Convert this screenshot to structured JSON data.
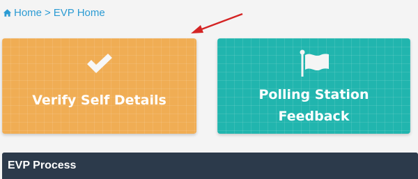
{
  "breadcrumb": {
    "home_label": "Home",
    "separator": ">",
    "current_label": "EVP Home",
    "icon": "home-icon"
  },
  "cards": {
    "verify": {
      "label": "Verify Self Details",
      "icon": "check-icon",
      "color": "#f0ad54"
    },
    "feedback": {
      "line1": "Polling Station",
      "line2": "Feedback",
      "icon": "flag-icon",
      "color": "#21b5ae"
    }
  },
  "process": {
    "title": "EVP Process",
    "color": "#2c3a4b"
  },
  "annotation": {
    "arrow_color": "#d42424"
  }
}
